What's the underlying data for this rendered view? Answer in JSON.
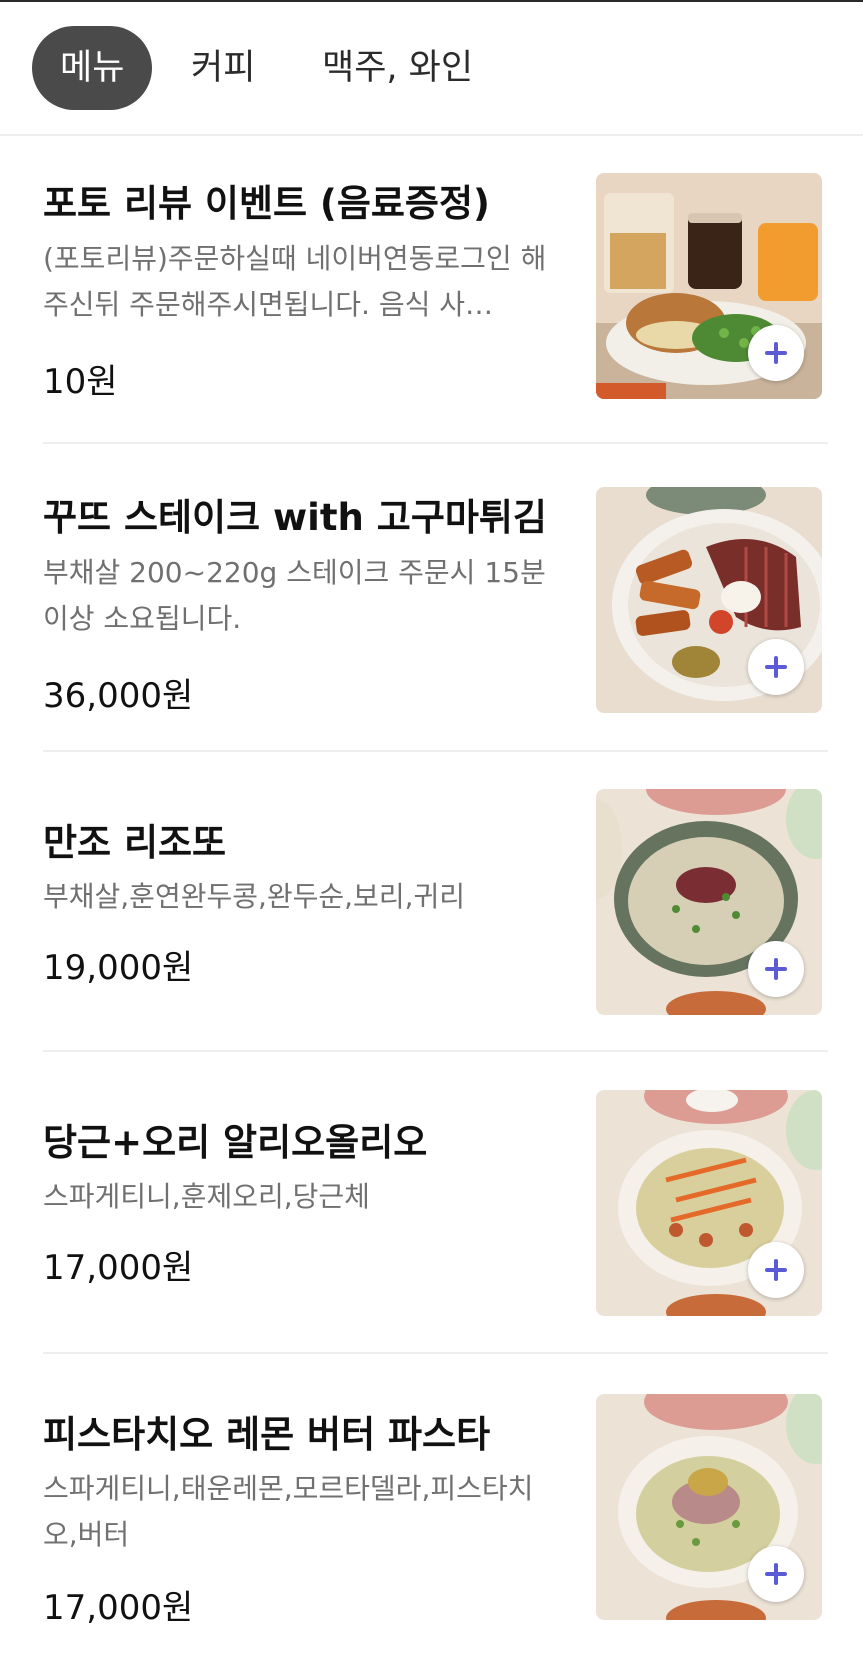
{
  "tabs": [
    {
      "label": "메뉴",
      "active": true
    },
    {
      "label": "커피",
      "active": false
    },
    {
      "label": "맥주, 와인",
      "active": false
    }
  ],
  "colors": {
    "active_tab_bg": "#4a4a4a",
    "add_button_plus": "#5b5bd6",
    "description_text": "#707070"
  },
  "items": [
    {
      "name": "포토 리뷰 이벤트 (음료증정)",
      "description": "(포토리뷰)주문하실때 네이버연동로그인 해주신뒤 주문해주시면됩니다. 음식 사…",
      "price": "10원",
      "image_icon": "food-photo-burger-drinks"
    },
    {
      "name": "꾸뜨 스테이크 with 고구마튀김",
      "description": "부채살 200~220g 스테이크 주문시 15분 이상 소요됩니다.",
      "price": "36,000원",
      "image_icon": "food-photo-steak-fries"
    },
    {
      "name": "만조 리조또",
      "description": "부채살,훈연완두콩,완두순,보리,귀리",
      "price": "19,000원",
      "image_icon": "food-photo-risotto"
    },
    {
      "name": "당근+오리 알리오올리오",
      "description": "스파게티니,훈제오리,당근체",
      "price": "17,000원",
      "image_icon": "food-photo-pasta-carrot"
    },
    {
      "name": "피스타치오 레몬 버터 파스타",
      "description": "스파게티니,태운레몬,모르타델라,피스타치오,버터",
      "price": "17,000원",
      "image_icon": "food-photo-pasta-lemon"
    }
  ]
}
